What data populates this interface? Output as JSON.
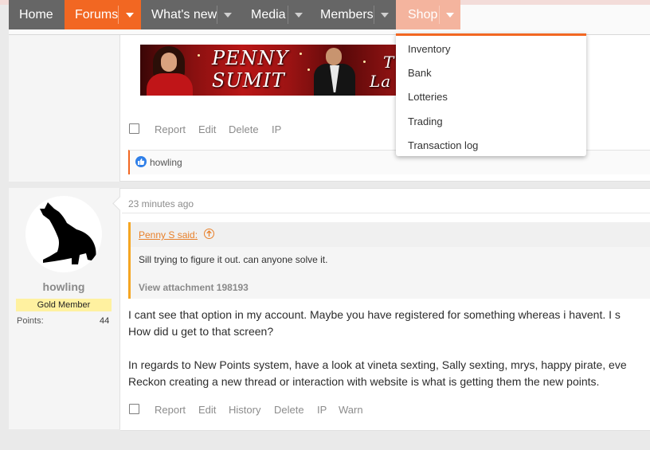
{
  "colors": {
    "brand_orange": "#f26722",
    "nav_gray": "#666666",
    "shop_active": "#f4b49e",
    "link_orange": "#e8802a",
    "rank_yellow": "#fff1a0",
    "like_blue": "#2f7fe8"
  },
  "nav": {
    "items": [
      {
        "label": "Home",
        "has_arrow": false
      },
      {
        "label": "Forums",
        "has_arrow": true
      },
      {
        "label": "What's new",
        "has_arrow": true
      },
      {
        "label": "Media",
        "has_arrow": true
      },
      {
        "label": "Members",
        "has_arrow": true
      },
      {
        "label": "Shop",
        "has_arrow": true
      }
    ]
  },
  "shop_menu": {
    "items": [
      "Inventory",
      "Bank",
      "Lotteries",
      "Trading",
      "Transaction log"
    ]
  },
  "post1": {
    "banner": {
      "line1": "PENNY",
      "line2": "SUMIT",
      "partial1": "T",
      "partial2": "La"
    },
    "actions": [
      "Report",
      "Edit",
      "Delete",
      "IP"
    ],
    "reaction": {
      "icon": "thumbs-up-icon",
      "users": "howling"
    }
  },
  "post2": {
    "author": {
      "name": "howling",
      "rank": "Gold Member",
      "points_label": "Points:",
      "points": "44",
      "avatar_icon": "howling-wolf-icon"
    },
    "timestamp": "23 minutes ago",
    "quote": {
      "author": "Penny S said:",
      "text": "Sill trying to figure it out. can anyone solve it.",
      "attachment": "View attachment 198193"
    },
    "body": [
      "I cant see that option in my account. Maybe you have registered for something whereas i havent. I s",
      "How did u get to that screen?",
      "In regards to New Points system, have a look at vineta sexting, Sally sexting, mrys, happy pirate, eve",
      "Reckon creating a new thread or interaction with website is what is getting them the new points."
    ],
    "actions": [
      "Report",
      "Edit",
      "History",
      "Delete",
      "IP",
      "Warn"
    ]
  }
}
